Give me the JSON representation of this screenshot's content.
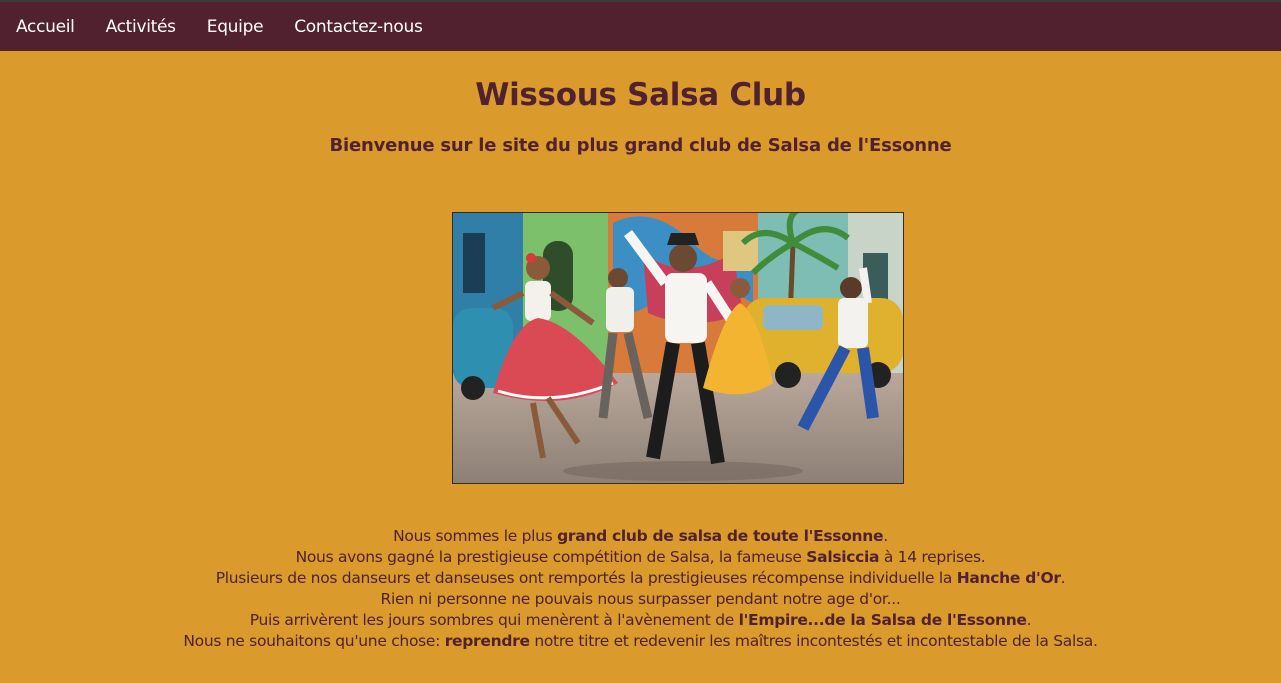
{
  "nav": {
    "items": [
      "Accueil",
      "Activités",
      "Equipe",
      "Contactez-nous"
    ]
  },
  "header": {
    "title": "Wissous Salsa Club",
    "subtitle": "Bienvenue sur le site du plus grand club de Salsa de l'Essonne"
  },
  "hero_image": {
    "alt": "",
    "scene": "salsa-dancers-street-illustration"
  },
  "body_text": {
    "line1_pre": "Nous sommes le plus ",
    "line1_bold": "grand club de salsa de toute l'Essonne",
    "line1_post": ".",
    "line2_pre": "Nous avons gagné la prestigieuse compétition de Salsa, la fameuse ",
    "line2_bold": "Salsiccia",
    "line2_post": " à 14 reprises.",
    "line3_pre": "Plusieurs de nos danseurs et danseuses ont remportés la prestigieuses récompense individuelle la ",
    "line3_bold": "Hanche d'Or",
    "line3_post": ".",
    "line4": "Rien ni personne ne pouvais nous surpasser pendant notre age d'or...",
    "line5_pre": "Puis arrivèrent les jours sombres qui menèrent à l'avènement de ",
    "line5_bold": "l'Empire...de la Salsa de l'Essonne",
    "line5_post": ".",
    "line6_pre": "Nous ne souhaitons qu'une chose: ",
    "line6_bold": "reprendre",
    "line6_post": " notre titre et redevenir les maîtres incontestés et incontestable de la Salsa."
  },
  "colors": {
    "background": "#DA9A2C",
    "navbar": "#512130",
    "text": "#512130"
  }
}
